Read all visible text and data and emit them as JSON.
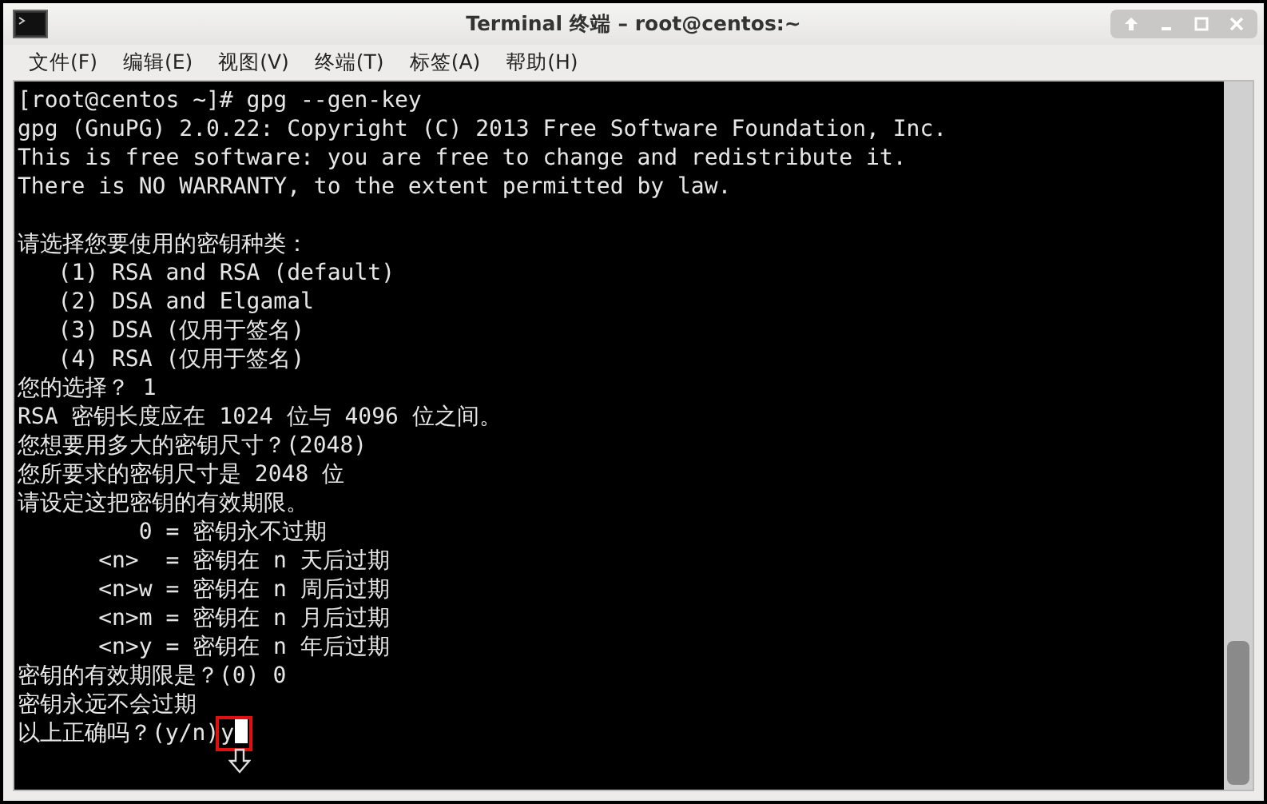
{
  "window": {
    "title": "Terminal 终端 – root@centos:~"
  },
  "menu": [
    "文件(F)",
    "编辑(E)",
    "视图(V)",
    "终端(T)",
    "标签(A)",
    "帮助(H)"
  ],
  "terminal": {
    "lines": [
      "[root@centos ~]# gpg --gen-key",
      "gpg (GnuPG) 2.0.22: Copyright (C) 2013 Free Software Foundation, Inc.",
      "This is free software: you are free to change and redistribute it.",
      "There is NO WARRANTY, to the extent permitted by law."
    ],
    "dialog_lines": [
      "请选择您要使用的密钥种类：",
      "   (1) RSA and RSA (default)",
      "   (2) DSA and Elgamal",
      "   (3) DSA (仅用于签名)",
      "   (4) RSA (仅用于签名)",
      "您的选择？ 1",
      "RSA 密钥长度应在 1024 位与 4096 位之间。",
      "您想要用多大的密钥尺寸？(2048)",
      "您所要求的密钥尺寸是 2048 位",
      "请设定这把密钥的有效期限。",
      "         0 = 密钥永不过期",
      "      <n>  = 密钥在 n 天后过期",
      "      <n>w = 密钥在 n 周后过期",
      "      <n>m = 密钥在 n 月后过期",
      "      <n>y = 密钥在 n 年后过期",
      "密钥的有效期限是？(0) 0",
      "密钥永远不会过期"
    ],
    "prompt": "以上正确吗？(y/n)",
    "input": "y"
  }
}
